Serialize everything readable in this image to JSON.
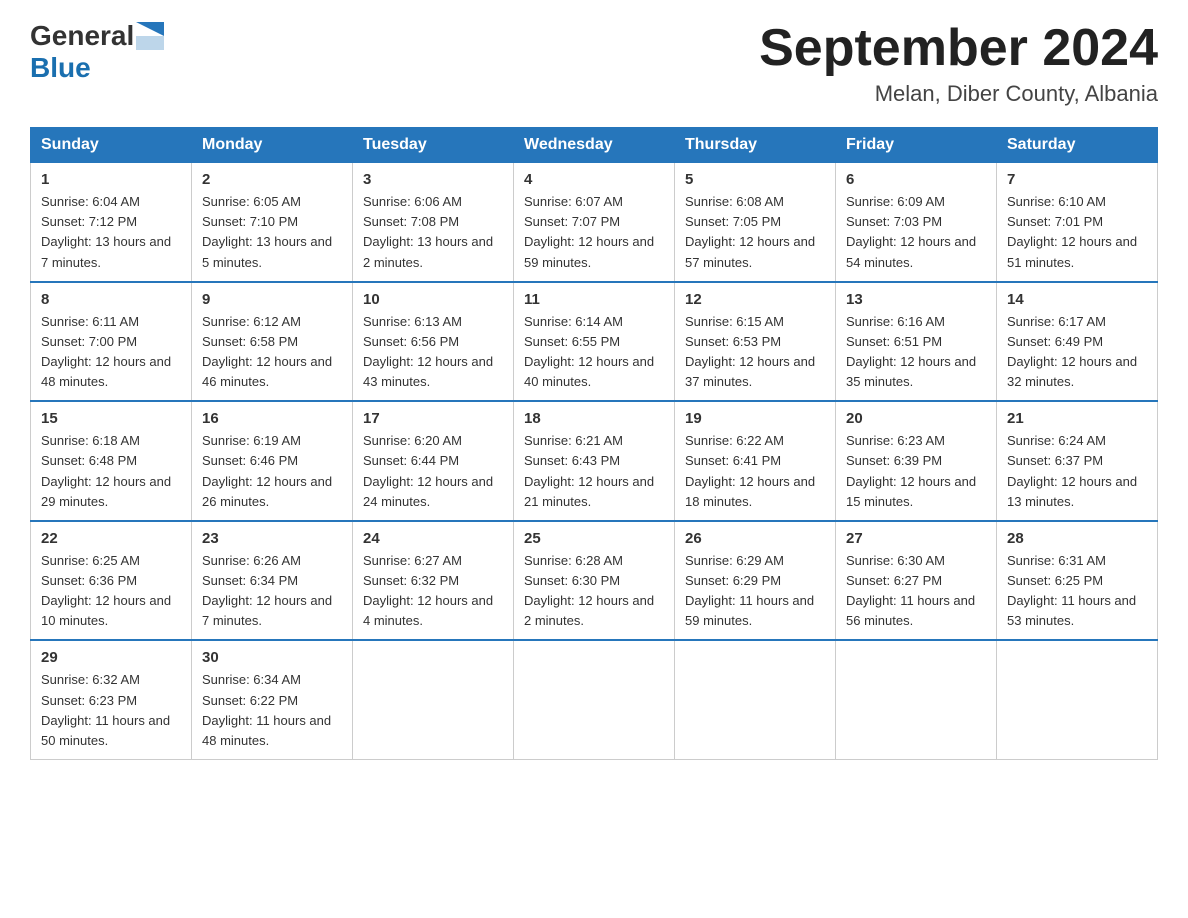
{
  "header": {
    "logo_general": "General",
    "logo_blue": "Blue",
    "month": "September 2024",
    "location": "Melan, Diber County, Albania"
  },
  "days_of_week": [
    "Sunday",
    "Monday",
    "Tuesday",
    "Wednesday",
    "Thursday",
    "Friday",
    "Saturday"
  ],
  "weeks": [
    [
      {
        "num": "1",
        "sunrise": "Sunrise: 6:04 AM",
        "sunset": "Sunset: 7:12 PM",
        "daylight": "Daylight: 13 hours and 7 minutes."
      },
      {
        "num": "2",
        "sunrise": "Sunrise: 6:05 AM",
        "sunset": "Sunset: 7:10 PM",
        "daylight": "Daylight: 13 hours and 5 minutes."
      },
      {
        "num": "3",
        "sunrise": "Sunrise: 6:06 AM",
        "sunset": "Sunset: 7:08 PM",
        "daylight": "Daylight: 13 hours and 2 minutes."
      },
      {
        "num": "4",
        "sunrise": "Sunrise: 6:07 AM",
        "sunset": "Sunset: 7:07 PM",
        "daylight": "Daylight: 12 hours and 59 minutes."
      },
      {
        "num": "5",
        "sunrise": "Sunrise: 6:08 AM",
        "sunset": "Sunset: 7:05 PM",
        "daylight": "Daylight: 12 hours and 57 minutes."
      },
      {
        "num": "6",
        "sunrise": "Sunrise: 6:09 AM",
        "sunset": "Sunset: 7:03 PM",
        "daylight": "Daylight: 12 hours and 54 minutes."
      },
      {
        "num": "7",
        "sunrise": "Sunrise: 6:10 AM",
        "sunset": "Sunset: 7:01 PM",
        "daylight": "Daylight: 12 hours and 51 minutes."
      }
    ],
    [
      {
        "num": "8",
        "sunrise": "Sunrise: 6:11 AM",
        "sunset": "Sunset: 7:00 PM",
        "daylight": "Daylight: 12 hours and 48 minutes."
      },
      {
        "num": "9",
        "sunrise": "Sunrise: 6:12 AM",
        "sunset": "Sunset: 6:58 PM",
        "daylight": "Daylight: 12 hours and 46 minutes."
      },
      {
        "num": "10",
        "sunrise": "Sunrise: 6:13 AM",
        "sunset": "Sunset: 6:56 PM",
        "daylight": "Daylight: 12 hours and 43 minutes."
      },
      {
        "num": "11",
        "sunrise": "Sunrise: 6:14 AM",
        "sunset": "Sunset: 6:55 PM",
        "daylight": "Daylight: 12 hours and 40 minutes."
      },
      {
        "num": "12",
        "sunrise": "Sunrise: 6:15 AM",
        "sunset": "Sunset: 6:53 PM",
        "daylight": "Daylight: 12 hours and 37 minutes."
      },
      {
        "num": "13",
        "sunrise": "Sunrise: 6:16 AM",
        "sunset": "Sunset: 6:51 PM",
        "daylight": "Daylight: 12 hours and 35 minutes."
      },
      {
        "num": "14",
        "sunrise": "Sunrise: 6:17 AM",
        "sunset": "Sunset: 6:49 PM",
        "daylight": "Daylight: 12 hours and 32 minutes."
      }
    ],
    [
      {
        "num": "15",
        "sunrise": "Sunrise: 6:18 AM",
        "sunset": "Sunset: 6:48 PM",
        "daylight": "Daylight: 12 hours and 29 minutes."
      },
      {
        "num": "16",
        "sunrise": "Sunrise: 6:19 AM",
        "sunset": "Sunset: 6:46 PM",
        "daylight": "Daylight: 12 hours and 26 minutes."
      },
      {
        "num": "17",
        "sunrise": "Sunrise: 6:20 AM",
        "sunset": "Sunset: 6:44 PM",
        "daylight": "Daylight: 12 hours and 24 minutes."
      },
      {
        "num": "18",
        "sunrise": "Sunrise: 6:21 AM",
        "sunset": "Sunset: 6:43 PM",
        "daylight": "Daylight: 12 hours and 21 minutes."
      },
      {
        "num": "19",
        "sunrise": "Sunrise: 6:22 AM",
        "sunset": "Sunset: 6:41 PM",
        "daylight": "Daylight: 12 hours and 18 minutes."
      },
      {
        "num": "20",
        "sunrise": "Sunrise: 6:23 AM",
        "sunset": "Sunset: 6:39 PM",
        "daylight": "Daylight: 12 hours and 15 minutes."
      },
      {
        "num": "21",
        "sunrise": "Sunrise: 6:24 AM",
        "sunset": "Sunset: 6:37 PM",
        "daylight": "Daylight: 12 hours and 13 minutes."
      }
    ],
    [
      {
        "num": "22",
        "sunrise": "Sunrise: 6:25 AM",
        "sunset": "Sunset: 6:36 PM",
        "daylight": "Daylight: 12 hours and 10 minutes."
      },
      {
        "num": "23",
        "sunrise": "Sunrise: 6:26 AM",
        "sunset": "Sunset: 6:34 PM",
        "daylight": "Daylight: 12 hours and 7 minutes."
      },
      {
        "num": "24",
        "sunrise": "Sunrise: 6:27 AM",
        "sunset": "Sunset: 6:32 PM",
        "daylight": "Daylight: 12 hours and 4 minutes."
      },
      {
        "num": "25",
        "sunrise": "Sunrise: 6:28 AM",
        "sunset": "Sunset: 6:30 PM",
        "daylight": "Daylight: 12 hours and 2 minutes."
      },
      {
        "num": "26",
        "sunrise": "Sunrise: 6:29 AM",
        "sunset": "Sunset: 6:29 PM",
        "daylight": "Daylight: 11 hours and 59 minutes."
      },
      {
        "num": "27",
        "sunrise": "Sunrise: 6:30 AM",
        "sunset": "Sunset: 6:27 PM",
        "daylight": "Daylight: 11 hours and 56 minutes."
      },
      {
        "num": "28",
        "sunrise": "Sunrise: 6:31 AM",
        "sunset": "Sunset: 6:25 PM",
        "daylight": "Daylight: 11 hours and 53 minutes."
      }
    ],
    [
      {
        "num": "29",
        "sunrise": "Sunrise: 6:32 AM",
        "sunset": "Sunset: 6:23 PM",
        "daylight": "Daylight: 11 hours and 50 minutes."
      },
      {
        "num": "30",
        "sunrise": "Sunrise: 6:34 AM",
        "sunset": "Sunset: 6:22 PM",
        "daylight": "Daylight: 11 hours and 48 minutes."
      },
      null,
      null,
      null,
      null,
      null
    ]
  ]
}
